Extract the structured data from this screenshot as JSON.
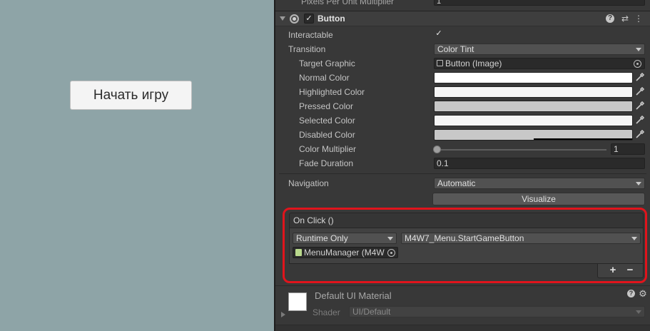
{
  "game_view": {
    "button_label": "Начать игру"
  },
  "inspector": {
    "top_strip": {
      "label": "Pixels Per Unit Multiplier",
      "value": "1"
    },
    "component": {
      "title": "Button",
      "enabled_check": "✓"
    },
    "interactable": {
      "label": "Interactable",
      "check": "✓"
    },
    "transition": {
      "label": "Transition",
      "value": "Color Tint"
    },
    "target_graphic": {
      "label": "Target Graphic",
      "value": "Button (Image)"
    },
    "colors": [
      {
        "label": "Normal Color",
        "color": "#ffffff",
        "alpha": 1.0
      },
      {
        "label": "Highlighted Color",
        "color": "#f5f5f5",
        "alpha": 1.0
      },
      {
        "label": "Pressed Color",
        "color": "#c8c8c8",
        "alpha": 1.0
      },
      {
        "label": "Selected Color",
        "color": "#f5f5f5",
        "alpha": 1.0
      },
      {
        "label": "Disabled Color",
        "color": "#c8c8c8",
        "alpha": 0.5
      }
    ],
    "color_multiplier": {
      "label": "Color Multiplier",
      "value": "1",
      "slider_fraction": 0.0
    },
    "fade_duration": {
      "label": "Fade Duration",
      "value": "0.1"
    },
    "navigation": {
      "label": "Navigation",
      "value": "Automatic",
      "visualize_label": "Visualize"
    },
    "on_click": {
      "header": "On Click ()",
      "runtime": "Runtime Only",
      "function": "M4W7_Menu.StartGameButton",
      "object": "MenuManager (M4W",
      "add": "+",
      "remove": "−"
    },
    "material": {
      "title": "Default UI Material",
      "shader_label": "Shader",
      "shader_value": "UI/Default"
    },
    "header_icons": {
      "help": "?",
      "presets": "⇄",
      "menu": "⋮"
    }
  },
  "colors": {
    "accent_highlight": "#e0141c",
    "game_bg": "#8ea4a7",
    "panel_bg": "#383838"
  }
}
